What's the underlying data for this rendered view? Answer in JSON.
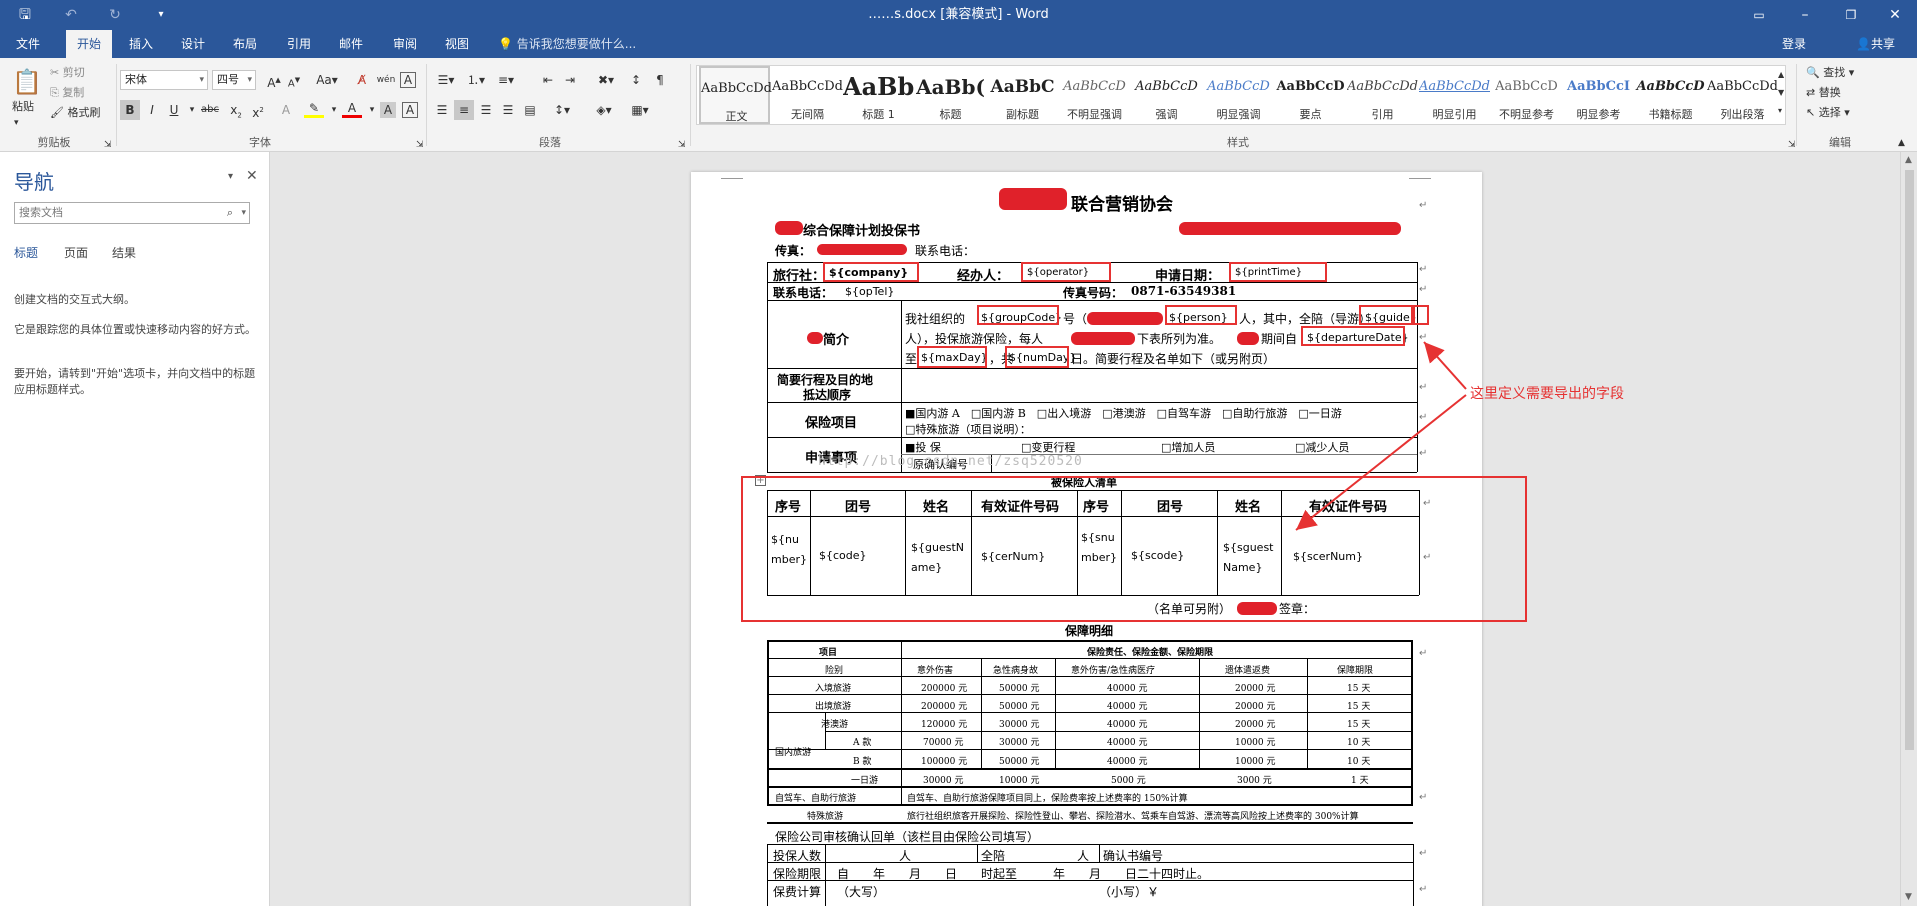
{
  "app": {
    "title": "……s.docx [兼容模式] - Word",
    "undo_icon": "undo-icon",
    "redo_icon": "redo-icon"
  },
  "tabs": [
    "文件",
    "开始",
    "插入",
    "设计",
    "布局",
    "引用",
    "邮件",
    "审阅",
    "视图"
  ],
  "tell_me": "告诉我您想要做什么...",
  "account": {
    "login": "登录",
    "share": "共享"
  },
  "ribbon": {
    "clipboard": {
      "paste": "粘贴",
      "cut": "剪切",
      "copy": "复制",
      "format_painter": "格式刷",
      "label": "剪贴板"
    },
    "font": {
      "name": "宋体",
      "size": "四号",
      "label": "字体"
    },
    "paragraph": {
      "label": "段落"
    },
    "styles": {
      "label": "样式",
      "items": [
        {
          "sample": "AaBbCcDd",
          "name": "正文"
        },
        {
          "sample": "AaBbCcDd",
          "name": "无间隔"
        },
        {
          "sample": "AaBb",
          "name": "标题 1"
        },
        {
          "sample": "AaBb(",
          "name": "标题"
        },
        {
          "sample": "AaBbC",
          "name": "副标题"
        },
        {
          "sample": "AaBbCcD",
          "name": "不明显强调"
        },
        {
          "sample": "AaBbCcD",
          "name": "强调"
        },
        {
          "sample": "AaBbCcD",
          "name": "明显强调"
        },
        {
          "sample": "AaBbCcD",
          "name": "要点"
        },
        {
          "sample": "AaBbCcDd",
          "name": "引用"
        },
        {
          "sample": "AaBbCcDd",
          "name": "明显引用"
        },
        {
          "sample": "AaBbCcD",
          "name": "不明显参考"
        },
        {
          "sample": "AaBbCcI",
          "name": "明显参考"
        },
        {
          "sample": "AaBbCcD",
          "name": "书籍标题"
        },
        {
          "sample": "AaBbCcDd",
          "name": "列出段落"
        }
      ]
    },
    "editing": {
      "find": "查找",
      "replace": "替换",
      "select": "选择",
      "label": "编辑"
    }
  },
  "nav": {
    "title": "导航",
    "search_placeholder": "搜索文档",
    "tabs": [
      "标题",
      "页面",
      "结果"
    ],
    "help": [
      "创建文档的交互式大纲。",
      "它是跟踪您的具体位置或快速移动内容的好方式。",
      "要开始，请转到\"开始\"选项卡，并向文档中的标题应用标题样式。"
    ]
  },
  "doc": {
    "title": "联合营销协会",
    "subtitle": "综合保障计划投保书",
    "fax_label": "传真：",
    "contact_label": "联系电话：",
    "agency_label": "旅行社：",
    "agency_value": "${company}",
    "operator_label": "经办人：",
    "operator_value": "${operator}",
    "apply_date_label": "申请日期：",
    "apply_date_value": "${printTime}",
    "tel_label": "联系电话：",
    "tel_value": "${opTel}",
    "fax_no_label": "传真号码：",
    "fax_no_value": "0871-63549381",
    "brief_label": "简介",
    "brief_line1a": "我社组织的",
    "brief_group": "${groupCode}",
    "brief_line1b": "号（",
    "brief_person": "${person}",
    "brief_line1c": "人，其中，全陪（导游）",
    "brief_guide": "${guide}",
    "brief_line2a": "人），投保旅游保险，每人",
    "brief_line2b": "下表所列为准。",
    "brief_line2c": "期间自",
    "brief_departure": "${departureDate}",
    "brief_line3a": "至",
    "brief_maxday": "${maxDay}",
    "brief_line3b": "，共",
    "brief_numday": "${numDay}",
    "brief_line3c": "日。简要行程及名单如下（或另附页）",
    "route_label": "简要行程及目的地",
    "route_label2": "抵达顺序",
    "insurance_label": "保险项目",
    "insurance_row1": "■国内游 A　□国内游 B　□出入境游　□港澳游　□自驾车游　□自助行旅游　□一日游",
    "insurance_row2": "□特殊旅游（项目说明）：",
    "apply_label": "申请事项",
    "apply_row1a": "■投 保",
    "apply_row1b": "□变更行程",
    "apply_row1c": "□增加人员",
    "apply_row1d": "□减少人员",
    "apply_row2": "原确认编号",
    "roster_title": "被保险人清单",
    "roster_headers": [
      "序号",
      "团号",
      "姓名",
      "有效证件号码",
      "序号",
      "团号",
      "姓名",
      "有效证件号码"
    ],
    "roster_row": [
      "${number}",
      "${code}",
      "${guestName}",
      "${cerNum}",
      "${snumber}",
      "${scode}",
      "${sguestName}",
      "${scerNum}"
    ],
    "roster_footer": "（名单可另附）",
    "roster_sign": "签章：",
    "coverage_title": "保障明细",
    "coverage_head_item": "项目",
    "coverage_head_main": "保险责任、保险金额、保险期限",
    "coverage_cols": [
      "险别",
      "意外伤害",
      "急性病身故",
      "意外伤害/急性病医疗",
      "遗体遣返费",
      "保障期限"
    ],
    "coverage_rows": [
      [
        "入境旅游",
        "200000 元",
        "50000 元",
        "40000 元",
        "20000 元",
        "15 天"
      ],
      [
        "出境旅游",
        "200000 元",
        "50000 元",
        "40000 元",
        "20000 元",
        "15 天"
      ],
      [
        "港澳游",
        "120000 元",
        "30000 元",
        "40000 元",
        "20000 元",
        "15 天"
      ],
      [
        "A 款",
        "70000 元",
        "30000 元",
        "40000 元",
        "10000 元",
        "10 天"
      ],
      [
        "B 款",
        "100000 元",
        "50000 元",
        "40000 元",
        "10000 元",
        "10 天"
      ],
      [
        "一日游",
        "30000 元",
        "10000 元",
        "5000 元",
        "3000 元",
        "1 天"
      ]
    ],
    "coverage_domestic": "国内旅游",
    "selfdrive_label": "自驾车、自助行旅游",
    "selfdrive_text": "自驾车、自助行旅游保障项目同上，保险费率按上述费率的 150%计算",
    "special_label": "特殊旅游",
    "special_text": "旅行社组织旅客开展探险、探险性登山、攀岩、探险潜水、驾乘车自驾游、漂流等高风险按上述费率的 300%计算",
    "review_title": "保险公司审核确认回单（该栏目由保险公司填写）",
    "review_insured": "投保人数",
    "review_person_unit": "人",
    "review_escort": "全陪",
    "review_confirm": "确认书编号",
    "review_period": "保险期限",
    "review_period_text": "自　　年　　月　　日　　时起至　　　年　　月　　日二十四时止。",
    "review_premium": "保费计算",
    "review_premium_big": "（大写）",
    "review_premium_small": "（小写）￥"
  },
  "annotation": "这里定义需要导出的字段",
  "watermark": "http://blog.csdn.net/zsq520520"
}
